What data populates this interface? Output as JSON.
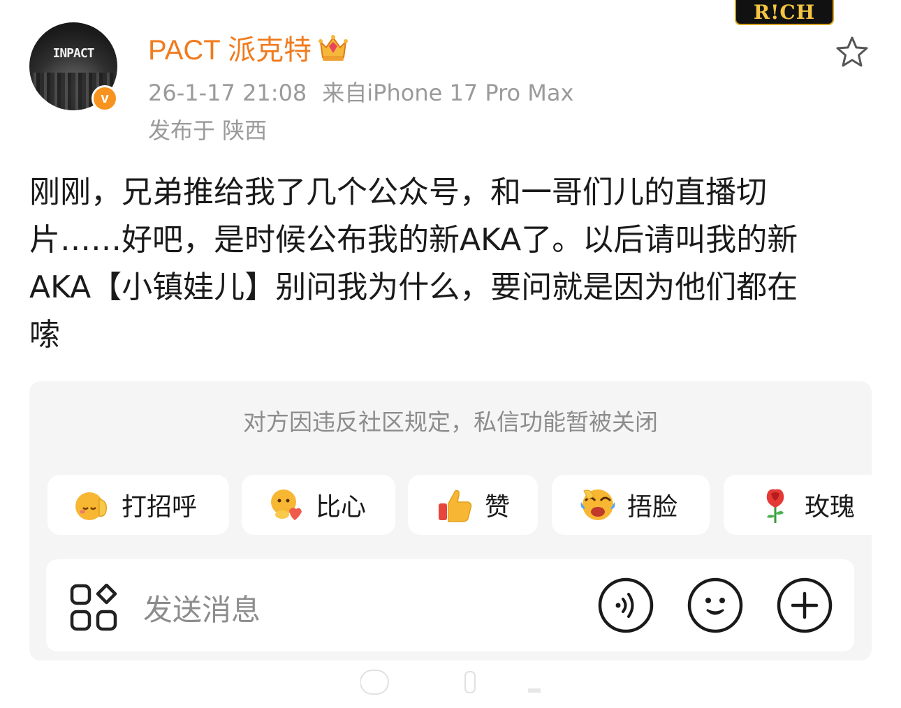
{
  "user": {
    "name": "PACT 派克特",
    "avatar_text": "INPACT",
    "verified_mark": "v"
  },
  "badge": {
    "text": "R!CH"
  },
  "meta": {
    "time": "26-1-17 21:08",
    "source": "来自iPhone 17 Pro Max",
    "location": "发布于 陕西"
  },
  "post": {
    "lines": [
      "刚刚，兄弟推给我了几个公众号，和一哥们儿的直播切",
      "片……好吧，是时候公布我的新AKA了。以后请叫我的新",
      "AKA【小镇娃儿】别问我为什么，要问就是因为他们都在",
      "嗦"
    ]
  },
  "dm": {
    "notice": "对方因违反社区规定，私信功能暂被关闭",
    "quick_replies": [
      {
        "label": "打招呼",
        "icon": "wave-emoji-icon"
      },
      {
        "label": "比心",
        "icon": "heart-hands-emoji-icon"
      },
      {
        "label": "赞",
        "icon": "thumbs-up-emoji-icon"
      },
      {
        "label": "捂脸",
        "icon": "facepalm-emoji-icon"
      },
      {
        "label": "玫瑰",
        "icon": "rose-emoji-icon"
      }
    ],
    "input_placeholder": "发送消息"
  },
  "colors": {
    "username": "#f07b1e",
    "verified": "#f7931e",
    "meta": "#9a9a9a",
    "panel_bg": "#f5f5f5"
  }
}
